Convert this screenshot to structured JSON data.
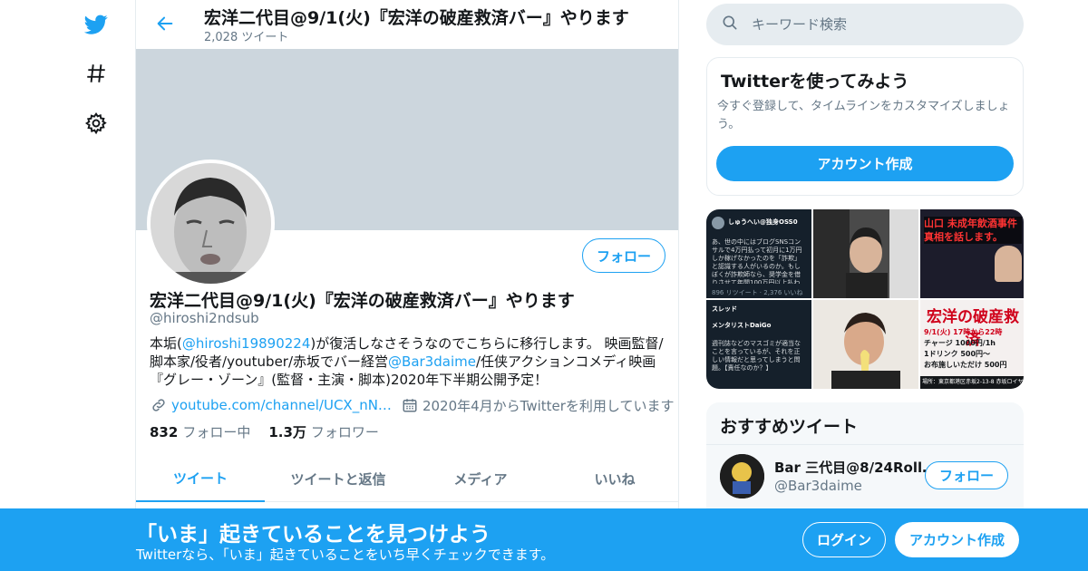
{
  "colors": {
    "accent": "#1da1f2",
    "banner": "#ccd6dd",
    "muted": "#657786",
    "text": "#14171a"
  },
  "nav": {
    "icons": [
      "twitter-bird-icon",
      "hashtag-icon",
      "gear-icon"
    ]
  },
  "header": {
    "title": "宏洋二代目@9/1(火)『宏洋の破産救済バー』やります",
    "tweet_count": "2,028 ツイート"
  },
  "profile": {
    "follow_label": "フォロー",
    "name": "宏洋二代目@9/1(火)『宏洋の破産救済バー』やります",
    "handle": "@hiroshi2ndsub",
    "bio": {
      "p1": "本垢(",
      "mention1": "@hiroshi19890224",
      "p2": ")が復活しなさそうなのでこちらに移行します。 映画監督/脚本家/役者/youtuber/赤坂でバー経営",
      "mention2": "@Bar3daime",
      "p3": "/任侠アクションコメディ映画『グレー・ゾーン』(監督・主演・脚本)2020年下半期公開予定！"
    },
    "website": "youtube.com/channel/UCX_nN…",
    "joined": "2020年4月からTwitterを利用しています",
    "following_count": "832",
    "following_label": "フォロー中",
    "followers_count": "1.3万",
    "followers_label": "フォロワー"
  },
  "tabs": [
    "ツイート",
    "ツイートと返信",
    "メディア",
    "いいね"
  ],
  "search": {
    "placeholder": "キーワード検索"
  },
  "signup_card": {
    "title": "Twitterを使ってみよう",
    "description": "今すぐ登録して、タイムラインをカスタマイズしましょう。",
    "button": "アカウント作成"
  },
  "media": {
    "t1_name": "しゅうへい@独身OSS0",
    "t1_text": "あ、世の中にはブログSNSコンサルで4万円払って初月に1万円しか稼げなかったのを「詐欺」と認識する人がいるのか。もしぼくが詐欺師なら、奨学金を借りさせて年間100万円以上払わせる大学も詐欺扱いになるんだけどな。普通詐欺と言ったら…",
    "t1_footer": "896 リツイート · 2,376 いいね",
    "t3_text": "山口 未成年飲酒事件 真相を話します。",
    "t4_header": "スレッド",
    "t4_name": "メンタリストDaiGo",
    "t4_text": "週刊誌などのマスゴミが適当なことを言っているが、それを正しい情報だと思ってしまうと問題。【責任なのか？】",
    "t6_title": "宏洋の破産救済",
    "t6_l1": "9/1(火) 17時から22時",
    "t6_l2": "チャージ 1000円/1h",
    "t6_l3": "1ドリンク 500円～",
    "t6_l4": "お布施しいただけ 500円",
    "t6_footer": "場所：東京都港区赤坂2-13-8 赤坂ロイヤル…"
  },
  "recommended": {
    "title": "おすすめツイート",
    "name": "Bar 三代目@8/24Roll…",
    "handle": "@Bar3daime",
    "follow_label": "フォロー"
  },
  "bottom_bar": {
    "title": "「いま」起きていることを見つけよう",
    "subtitle": "Twitterなら、「いま」起きていることをいち早くチェックできます。",
    "login": "ログイン",
    "signup": "アカウント作成"
  }
}
